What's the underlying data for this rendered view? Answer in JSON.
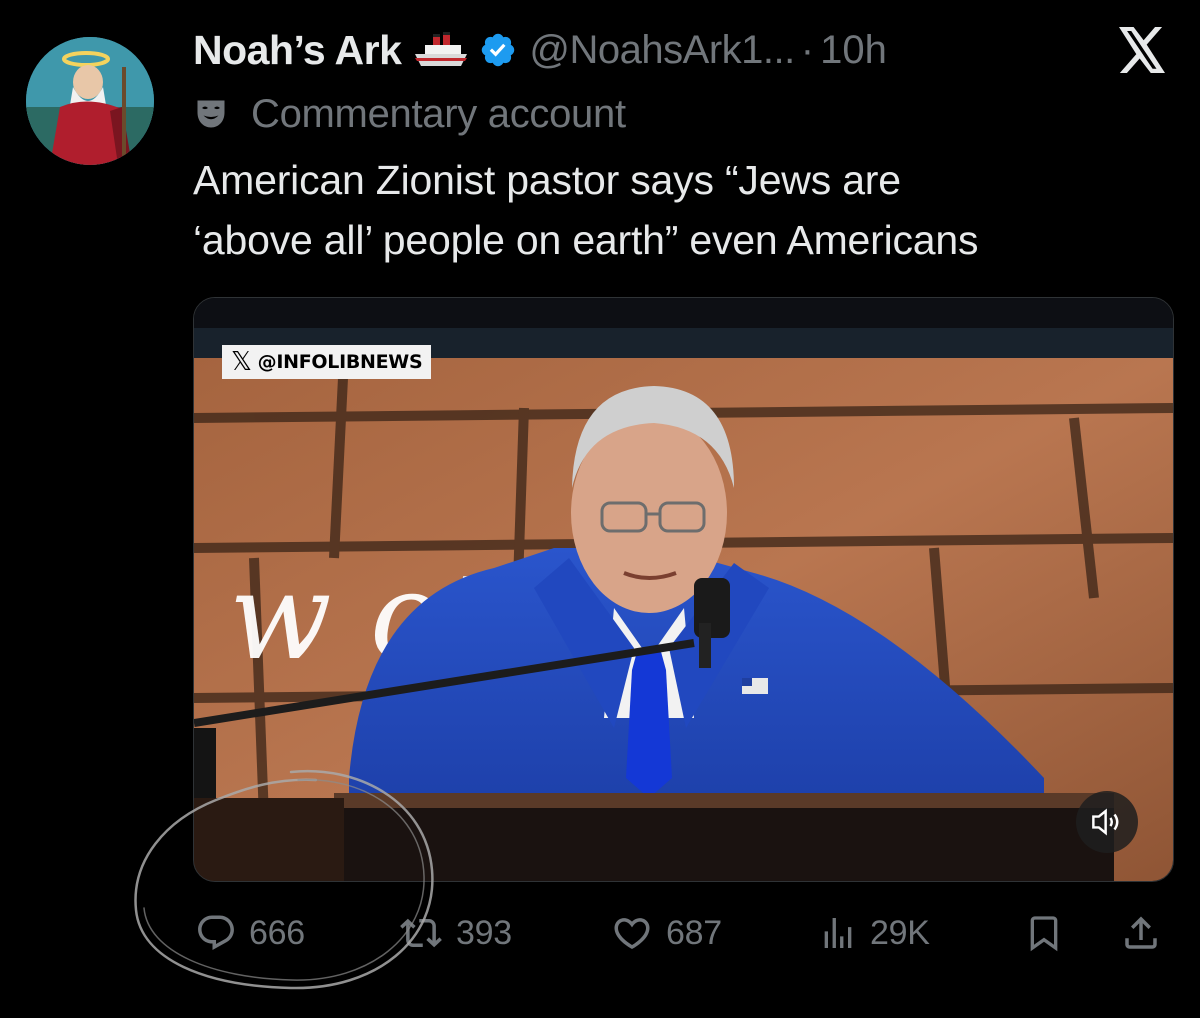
{
  "post": {
    "author": {
      "display_name": "Noah’s Ark",
      "handle": "@NoahsArk1...",
      "separator": "·",
      "time": "10h",
      "label": "Commentary account"
    },
    "text_line1": "American Zionist pastor says “Jews are",
    "text_line2": "‘above all’ people on earth” even Americans",
    "media": {
      "watermark_handle": "@INFOLIBNEWS",
      "watermark_x": "𝕏",
      "backdrop_text": "w       ot"
    },
    "actions": {
      "replies": "666",
      "reposts": "393",
      "likes": "687",
      "views": "29K"
    }
  },
  "colors": {
    "background": "#000000",
    "primary_text": "#e7e9ea",
    "secondary_text": "#71767b",
    "verified": "#1d9bf0",
    "suit": "#1f46b8"
  },
  "icons": [
    "ship-icon",
    "verified-icon",
    "x-logo-icon",
    "mask-icon",
    "speaker-icon",
    "reply-icon",
    "repost-icon",
    "like-icon",
    "views-icon",
    "bookmark-icon",
    "share-icon"
  ]
}
